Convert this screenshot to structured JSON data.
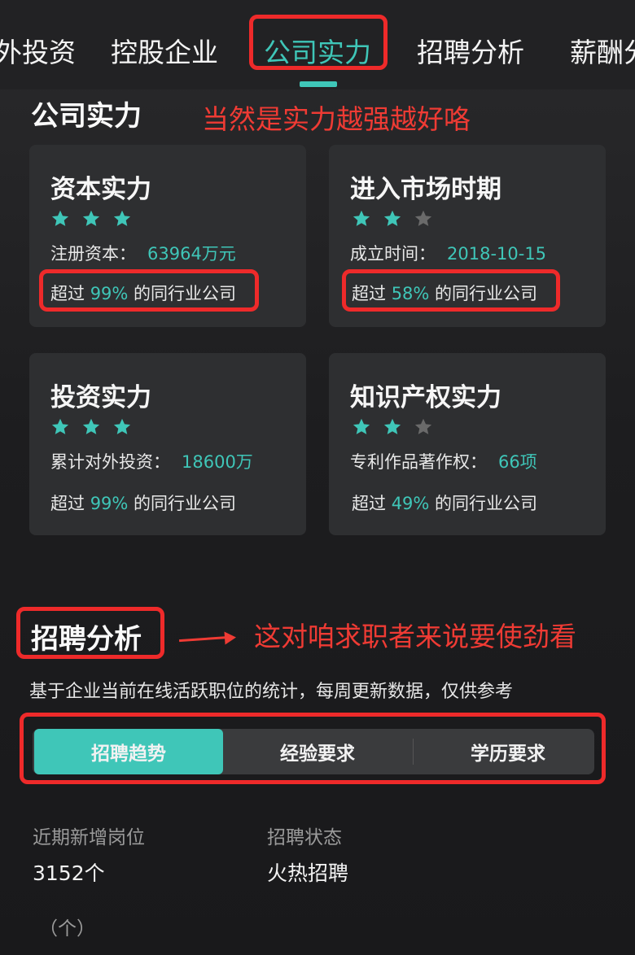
{
  "tabs": [
    {
      "label": "外投资"
    },
    {
      "label": "控股企业"
    },
    {
      "label": "公司实力"
    },
    {
      "label": "招聘分析"
    },
    {
      "label": "薪酬分"
    }
  ],
  "strength": {
    "title": "公司实力",
    "annotation": "当然是实力越强越好咯",
    "cards": [
      {
        "title": "资本实力",
        "stars": 3,
        "metric_label": "注册资本：",
        "metric_value": "63964万元",
        "pct_prefix": "超过 ",
        "pct_value": "99%",
        "pct_suffix": " 的同行业公司"
      },
      {
        "title": "进入市场时期",
        "stars": 2,
        "metric_label": "成立时间：",
        "metric_value": "2018-10-15",
        "pct_prefix": "超过 ",
        "pct_value": "58%",
        "pct_suffix": " 的同行业公司"
      },
      {
        "title": "投资实力",
        "stars": 3,
        "metric_label": "累计对外投资：",
        "metric_value": "18600万",
        "pct_prefix": "超过 ",
        "pct_value": "99%",
        "pct_suffix": " 的同行业公司"
      },
      {
        "title": "知识产权实力",
        "stars": 2,
        "metric_label": "专利作品著作权：",
        "metric_value": "66项",
        "pct_prefix": "超过 ",
        "pct_value": "49%",
        "pct_suffix": " 的同行业公司"
      }
    ]
  },
  "recruit": {
    "title": "招聘分析",
    "annotation": "这对咱求职者来说要使劲看",
    "subtitle": "基于企业当前在线活跃职位的统计，每周更新数据，仅供参考",
    "segments": [
      "招聘趋势",
      "经验要求",
      "学历要求"
    ],
    "stats": [
      {
        "label": "近期新增岗位",
        "value": "3152个"
      },
      {
        "label": "招聘状态",
        "value": "火热招聘"
      }
    ],
    "unit": "（个）"
  },
  "colors": {
    "accent": "#3fc6b8",
    "annotation_red": "#ee2a2a",
    "star_off": "#6a6a6a"
  },
  "icons": {
    "star": "star-icon",
    "arrow": "arrow-right-icon"
  }
}
